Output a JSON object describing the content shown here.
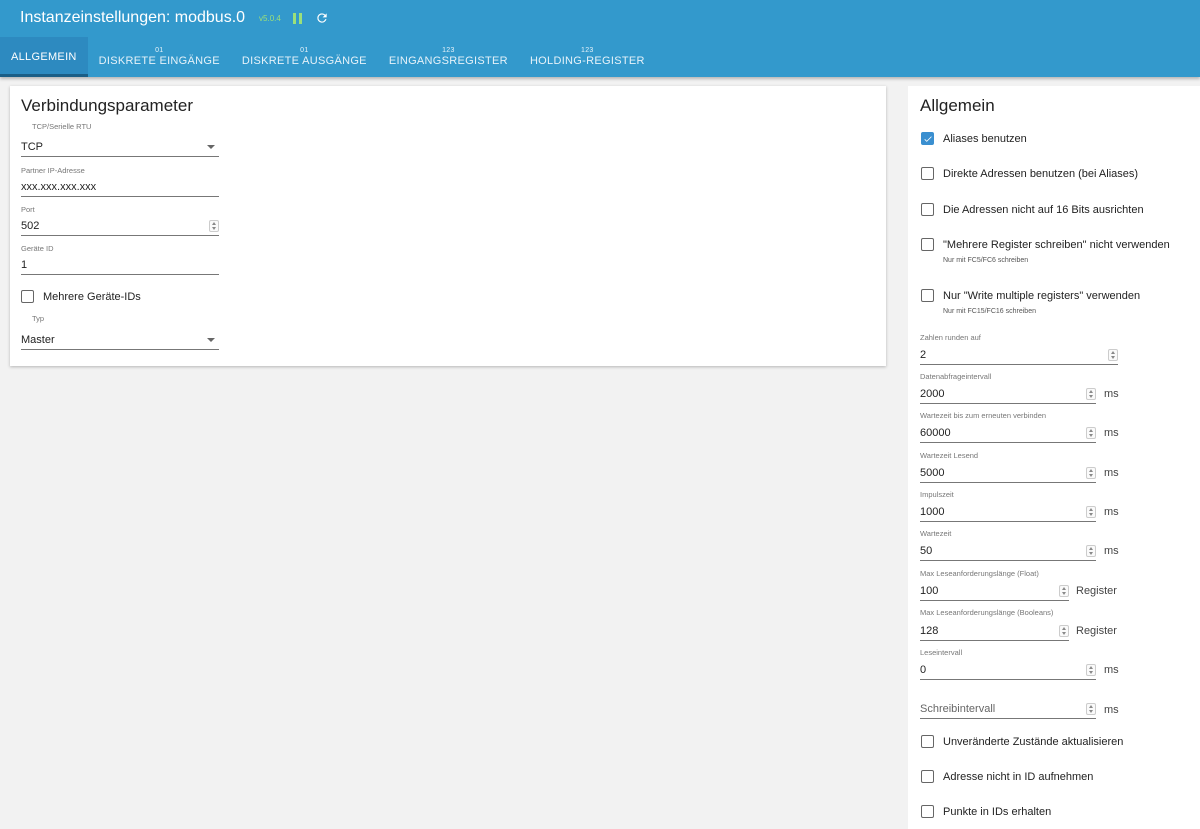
{
  "header": {
    "title": "Instanzeinstellungen: modbus.0",
    "version": "v5.0.4",
    "tabs": [
      {
        "label": "ALLGEMEIN",
        "count": ""
      },
      {
        "label": "DISKRETE EINGÄNGE",
        "count": "01"
      },
      {
        "label": "DISKRETE AUSGÄNGE",
        "count": "01"
      },
      {
        "label": "EINGANGSREGISTER",
        "count": "123"
      },
      {
        "label": "HOLDING-REGISTER",
        "count": "123"
      }
    ]
  },
  "left": {
    "title": "Verbindungsparameter",
    "conn_type_label": "TCP/Serielle RTU",
    "conn_type_value": "TCP",
    "ip_label": "Partner IP-Adresse",
    "ip_value": "xxx.xxx.xxx.xxx",
    "port_label": "Port",
    "port_value": "502",
    "device_label": "Geräte ID",
    "device_value": "1",
    "multi_ids_label": "Mehrere Geräte-IDs",
    "type_label": "Typ",
    "type_value": "Master"
  },
  "right": {
    "title": "Allgemein",
    "checks": {
      "aliases": "Aliases benutzen",
      "direct": "Direkte Adressen benutzen (bei Aliases)",
      "align": "Die Adressen nicht auf 16 Bits ausrichten",
      "multi_write": "\"Mehrere Register schreiben\" nicht verwenden",
      "multi_write_hint": "Nur mit FC5/FC6 schreiben",
      "only_multi": "Nur \"Write multiple registers\" verwenden",
      "only_multi_hint": "Nur mit FC15/FC16 schreiben",
      "unchanged": "Unveränderte Zustände aktualisieren",
      "no_address": "Adresse nicht in ID aufnehmen",
      "dots": "Punkte in IDs erhalten"
    },
    "fields": {
      "round_label": "Zahlen runden auf",
      "round_value": "2",
      "poll_label": "Datenabfrageintervall",
      "poll_value": "2000",
      "reconnect_label": "Wartezeit bis zum erneuten verbinden",
      "reconnect_value": "60000",
      "read_wait_label": "Wartezeit Lesend",
      "read_wait_value": "5000",
      "pulse_label": "Impulszeit",
      "pulse_value": "1000",
      "wait_label": "Wartezeit",
      "wait_value": "50",
      "max_float_label": "Max Leseanforderungslänge (Float)",
      "max_float_value": "100",
      "max_bool_label": "Max Leseanforderungslänge (Booleans)",
      "max_bool_value": "128",
      "read_interval_label": "Leseintervall",
      "read_interval_value": "0",
      "write_interval_placeholder": "Schreibintervall"
    },
    "units": {
      "ms": "ms",
      "register": "Register"
    }
  },
  "colors": {
    "appbar": "#3399cc",
    "accent": "#3a8fd0",
    "version": "#9be07a"
  }
}
